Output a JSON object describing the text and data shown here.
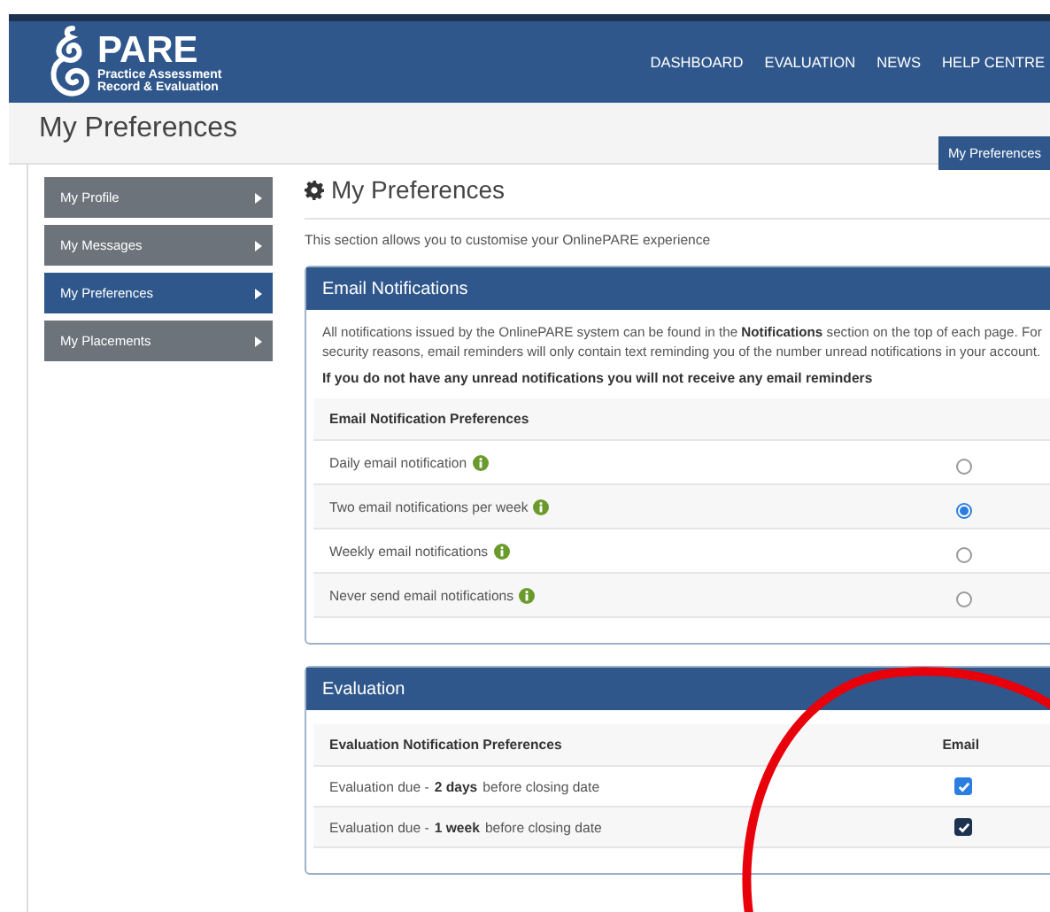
{
  "header": {
    "logo_title": "PARE",
    "logo_subtitle": [
      "Practice Assessment",
      "Record & Evaluation"
    ],
    "nav": [
      "DASHBOARD",
      "EVALUATION",
      "NEWS",
      "HELP CENTRE"
    ]
  },
  "page_title": "My Preferences",
  "breadcrumb": "My Preferences",
  "sidebar": {
    "items": [
      {
        "label": "My Profile",
        "selected": false
      },
      {
        "label": "My Messages",
        "selected": false
      },
      {
        "label": "My Preferences",
        "selected": true
      },
      {
        "label": "My Placements",
        "selected": false
      }
    ]
  },
  "content": {
    "heading": "My Preferences",
    "intro": "This section allows you to customise your OnlinePARE experience",
    "email_panel": {
      "title": "Email Notifications",
      "description": "All notifications issued by the OnlinePARE system can be found in the **Notifications** section on the top of each page. For security reasons, email reminders will only contain text reminding you of the number unread notifications in your account.",
      "warning": "If you do not have any unread notifications you will not receive any email reminders",
      "table_heading": "Email Notification Preferences",
      "options": [
        {
          "label": "Daily email notification",
          "selected": false
        },
        {
          "label": "Two email notifications per week",
          "selected": true
        },
        {
          "label": "Weekly email notifications",
          "selected": false
        },
        {
          "label": "Never send email notifications",
          "selected": false
        }
      ]
    },
    "evaluation_panel": {
      "title": "Evaluation",
      "columns": [
        "Evaluation Notification Preferences",
        "Email"
      ],
      "rows": [
        {
          "label": "Evaluation due - **2 days** before closing date",
          "checked": true
        },
        {
          "label": "Evaluation due - **1 week** before closing date",
          "checked": true
        }
      ]
    }
  }
}
